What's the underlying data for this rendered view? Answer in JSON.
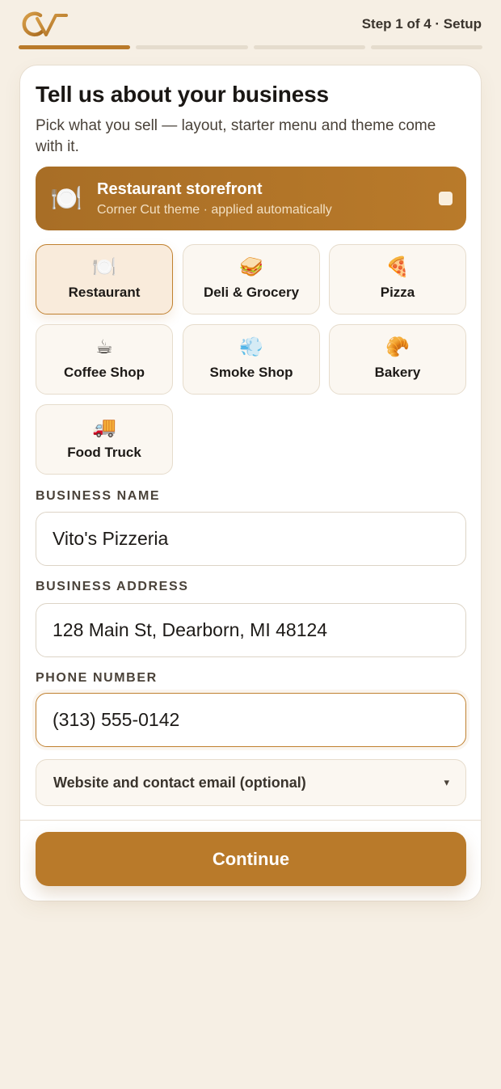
{
  "header": {
    "logo_icon": "brand-logo-icon",
    "step_label": "Step 1 of 4 · Setup",
    "progress": {
      "current": 1,
      "total": 4
    }
  },
  "colors": {
    "accent": "#b97a2a",
    "background": "#f6efe4",
    "selected_tile_bg": "#f9ebdb"
  },
  "main": {
    "title": "Tell us about your business",
    "subtitle": "Pick what you sell — layout, starter menu and theme come with it.",
    "banner": {
      "icon": "🍽️",
      "title": "Restaurant storefront",
      "subtitle": "Corner Cut theme · applied automatically"
    },
    "business_types": [
      {
        "icon": "🍽️",
        "label": "Restaurant",
        "selected": true
      },
      {
        "icon": "🥪",
        "label": "Deli & Grocery",
        "selected": false
      },
      {
        "icon": "🍕",
        "label": "Pizza",
        "selected": false
      },
      {
        "icon": "☕",
        "label": "Coffee Shop",
        "selected": false
      },
      {
        "icon": "💨",
        "label": "Smoke Shop",
        "selected": false
      },
      {
        "icon": "🥐",
        "label": "Bakery",
        "selected": false
      },
      {
        "icon": "🚚",
        "label": "Food Truck",
        "selected": false
      }
    ],
    "fields": {
      "business_name": {
        "label": "BUSINESS NAME",
        "value": "Vito's Pizzeria"
      },
      "business_address": {
        "label": "BUSINESS ADDRESS",
        "value": "128 Main St, Dearborn, MI 48124"
      },
      "phone_number": {
        "label": "PHONE NUMBER",
        "value": "(313) 555-0142"
      }
    },
    "optional_section": {
      "label": "Website and contact email (optional)",
      "caret": "▾"
    },
    "continue_label": "Continue"
  }
}
